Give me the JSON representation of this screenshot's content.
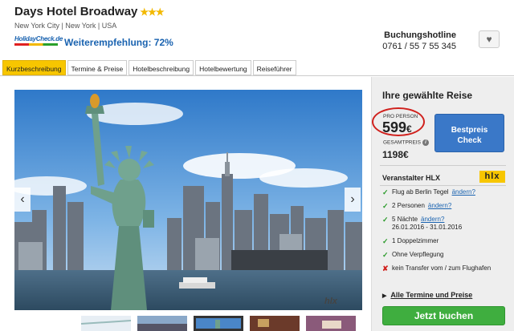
{
  "hotel": {
    "name": "Days Hotel Broadway",
    "stars": "★★★",
    "location": "New York City | New York | USA"
  },
  "holidaycheck": {
    "logo_text": "HolidayCheck.de",
    "recommendation": "Weiterempfehlung: 72%"
  },
  "hotline": {
    "label": "Buchungshotline",
    "number": "0761 / 55 7 55 345"
  },
  "fav_icon": "heart-icon",
  "tabs": [
    {
      "label": "Kurzbeschreibung",
      "active": true
    },
    {
      "label": "Termine & Preise",
      "active": false
    },
    {
      "label": "Hotelbeschreibung",
      "active": false
    },
    {
      "label": "Hotelbewertung",
      "active": false
    },
    {
      "label": "Reiseführer",
      "active": false
    }
  ],
  "gallery": {
    "prev": "‹",
    "next": "›",
    "watermark": "hlx"
  },
  "sidebar": {
    "title": "Ihre gewählte Reise",
    "pro_person_label": "PRO PERSON",
    "price": "599",
    "currency": "€",
    "gesamt_label": "GESAMTPREIS",
    "gesamt_price": "1198",
    "bestpreis_line1": "Bestpreis",
    "bestpreis_line2": "Check",
    "veranstalter": "Veranstalter HLX",
    "hlx_logo": "hlx",
    "features": [
      {
        "text": "Flug ab Berlin Tegel",
        "change": "ändern?",
        "sub": "",
        "ok": true
      },
      {
        "text": "2 Personen",
        "change": "ändern?",
        "sub": "",
        "ok": true
      },
      {
        "text": "5 Nächte",
        "change": "ändern?",
        "sub": "26.01.2016 - 31.01.2016",
        "ok": true
      },
      {
        "text": "1 Doppelzimmer",
        "change": "",
        "sub": "",
        "ok": true
      },
      {
        "text": "Ohne Verpflegung",
        "change": "",
        "sub": "",
        "ok": true
      },
      {
        "text": "kein Transfer vom / zum Flughafen",
        "change": "",
        "sub": "",
        "ok": false
      }
    ],
    "alle_termine": "Alle Termine und Preise",
    "jetzt_buchen": "Jetzt buchen"
  },
  "colors": {
    "accent_blue": "#1a63b0",
    "tab_active": "#f7c600",
    "book_green": "#3fae3f",
    "highlight_red": "#d0211d"
  }
}
